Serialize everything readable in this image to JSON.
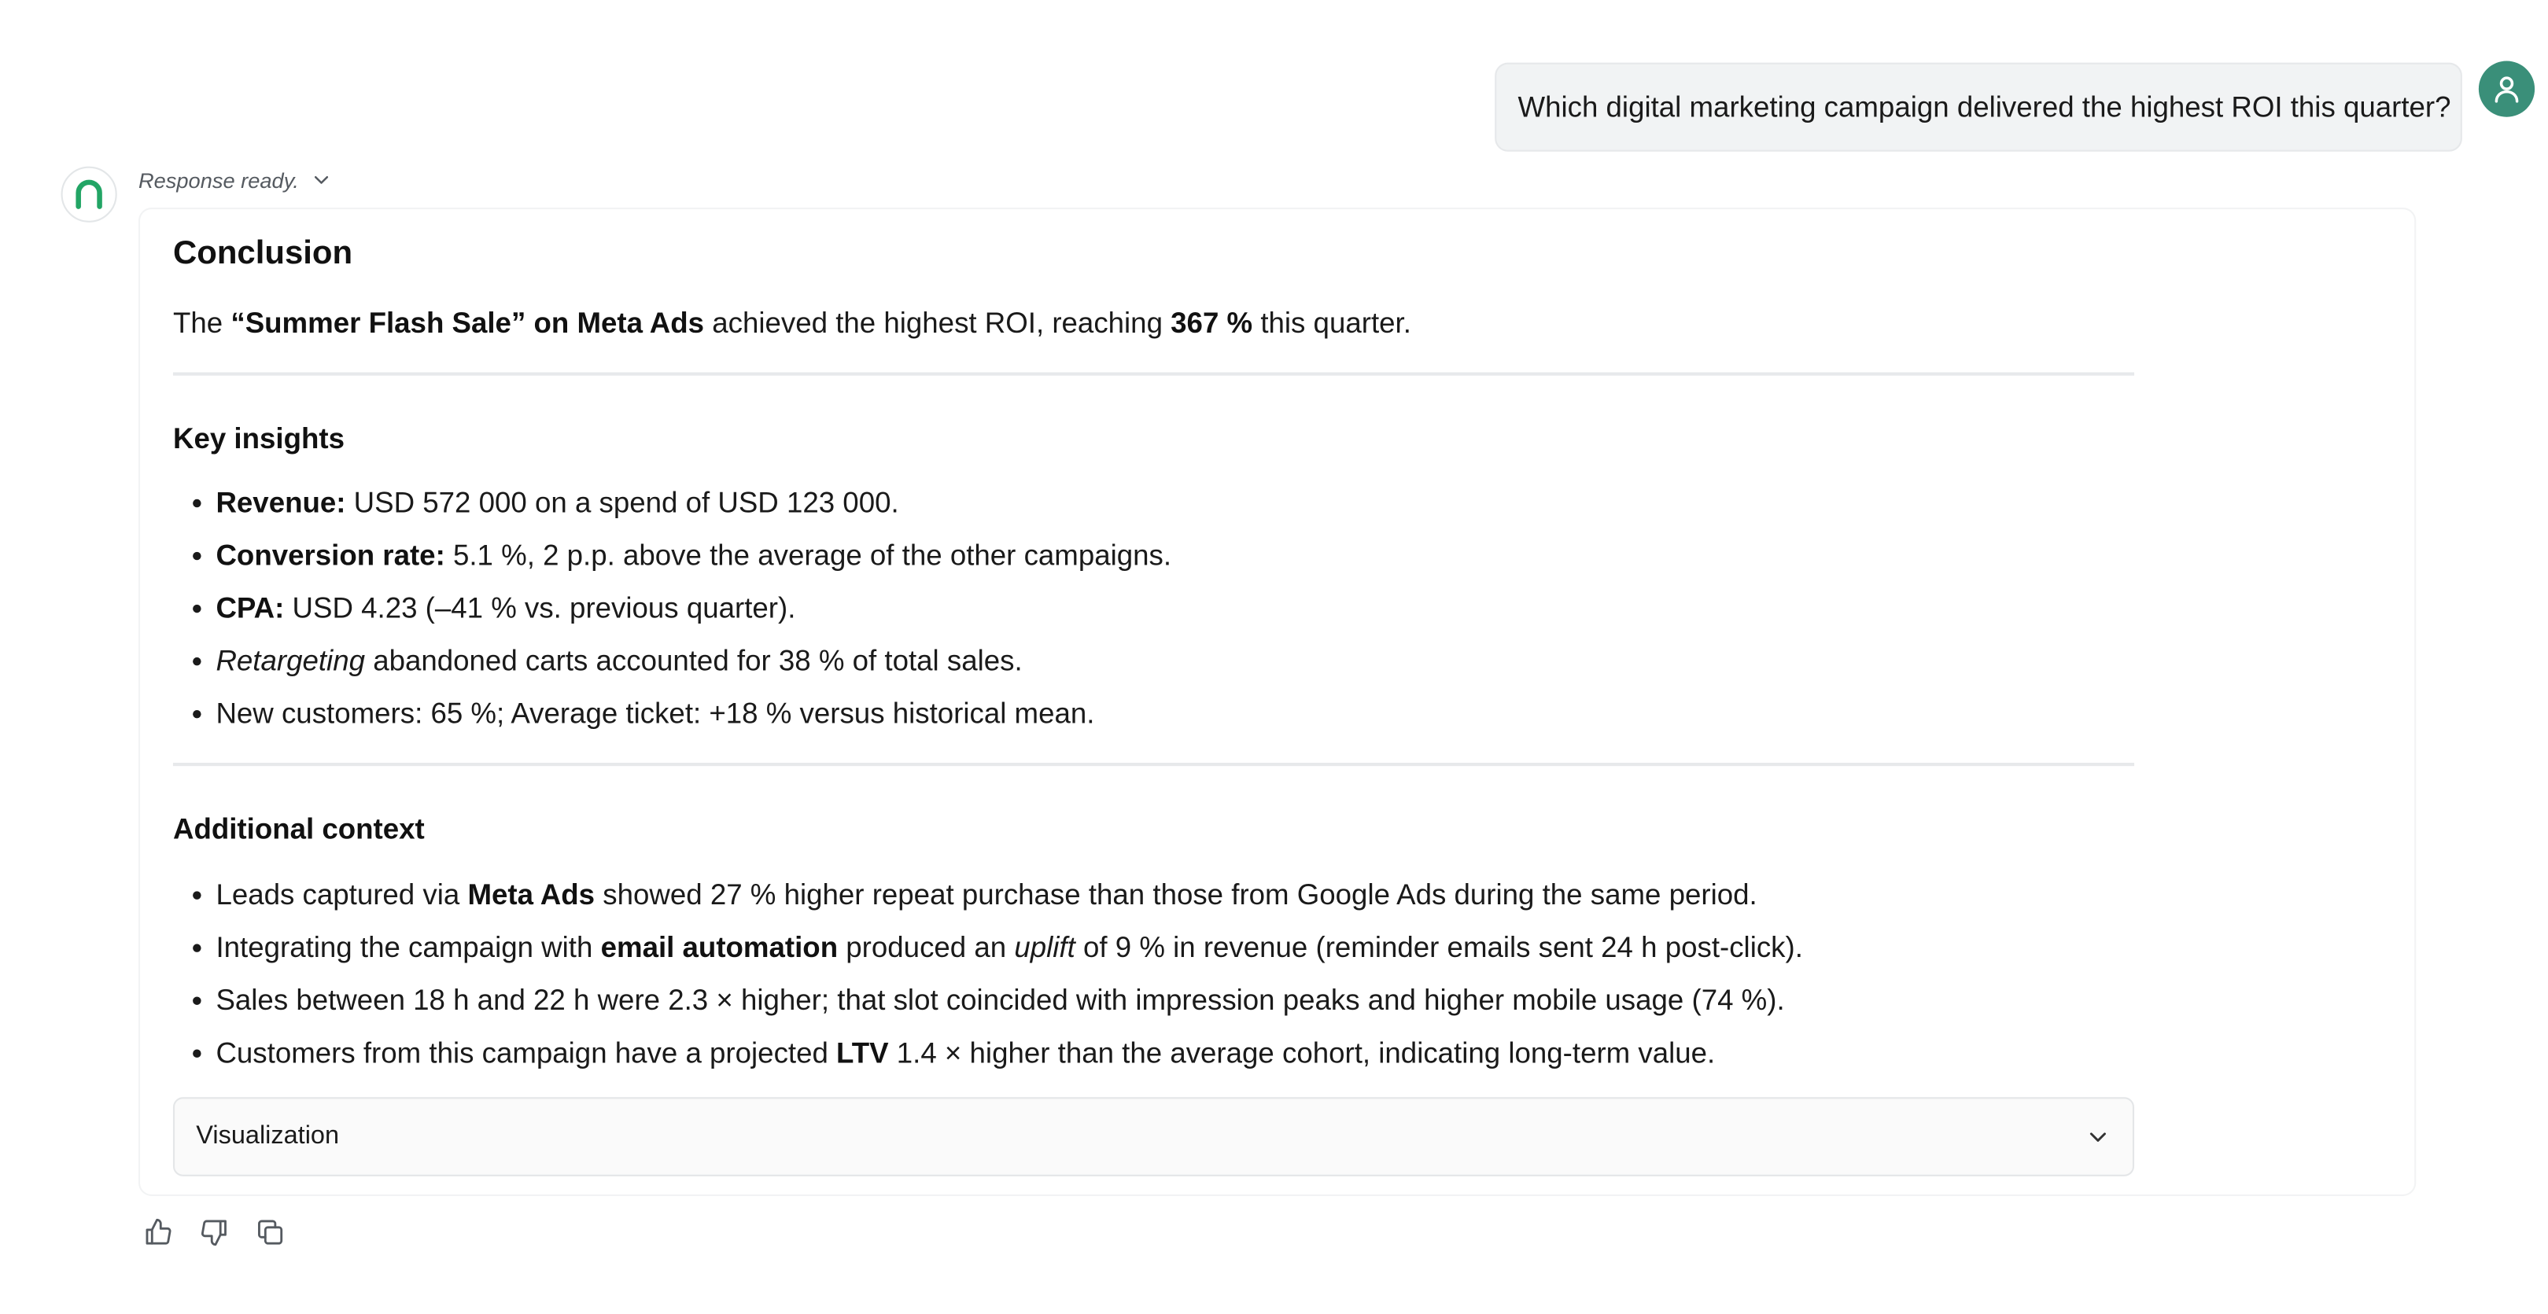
{
  "user_message": {
    "text": "Which digital marketing campaign delivered the highest ROI this quarter?",
    "avatar_icon": "user-icon",
    "avatar_color": "#3a8f79"
  },
  "assistant": {
    "logo_icon": "arch-logo-icon",
    "logo_color": "#22a565",
    "status_text": "Response ready.",
    "conclusion": {
      "heading": "Conclusion",
      "sentence": {
        "p1": "The ",
        "campaign": "“Summer Flash Sale” on Meta Ads",
        "p2": " achieved the highest ROI, reaching ",
        "roi": "367 %",
        "p3": " this quarter."
      }
    },
    "key_insights": {
      "heading": "Key insights",
      "items": [
        {
          "label": "Revenue:",
          "text": " USD 572 000 on a spend of USD 123 000."
        },
        {
          "label": "Conversion rate:",
          "text": " 5.1 %, 2 p.p. above the average of the other campaigns."
        },
        {
          "label": "CPA:",
          "text": " USD 4.23 (–41 % vs. previous quarter)."
        },
        {
          "italic": "Retargeting",
          "text": " abandoned carts accounted for 38 % of total sales."
        },
        {
          "text": "New customers: 65 %; Average ticket: +18 % versus historical mean."
        }
      ]
    },
    "additional_context": {
      "heading": "Additional context",
      "items": [
        {
          "p1": "Leads captured via ",
          "bold": "Meta Ads",
          "p2": " showed 27 % higher repeat purchase than those from Google Ads during the same period."
        },
        {
          "p1": "Integrating the campaign with ",
          "bold": "email automation",
          "p2": " produced an ",
          "italic": "uplift",
          "p3": " of 9 % in revenue (reminder emails sent 24 h post-click)."
        },
        {
          "text": "Sales between 18 h and 22 h were 2.3 × higher; that slot coincided with impression peaks and higher mobile usage (74 %)."
        },
        {
          "p1": "Customers from this campaign have a projected ",
          "bold": "LTV",
          "p2": " 1.4 × higher than the average cohort, indicating long-term value."
        }
      ]
    },
    "visualization": {
      "label": "Visualization",
      "expanded": false
    },
    "actions": [
      {
        "icon": "thumbs-up-icon"
      },
      {
        "icon": "thumbs-down-icon"
      },
      {
        "icon": "copy-icon"
      }
    ]
  }
}
